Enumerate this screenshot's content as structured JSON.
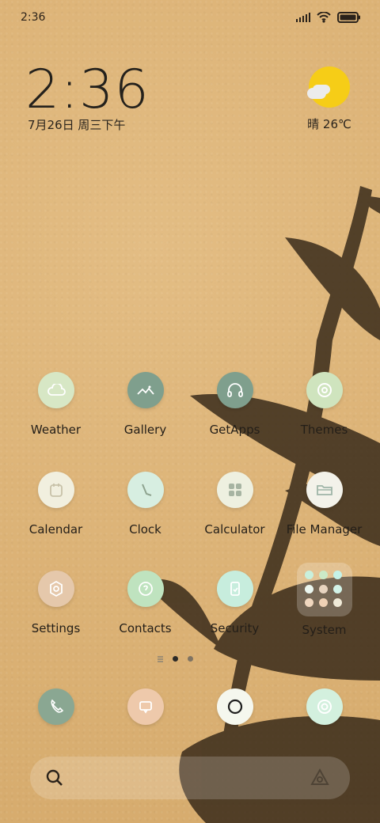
{
  "status_bar": {
    "time": "2:36",
    "icons": [
      "signal-icon",
      "wifi-icon",
      "battery-icon"
    ]
  },
  "clock_widget": {
    "time": "2:36",
    "date": "7月26日 周三下午"
  },
  "weather_widget": {
    "condition_icon": "partly-sunny-icon",
    "text": "晴 26℃"
  },
  "home_apps": [
    {
      "label": "Weather",
      "icon": "cloud-icon",
      "color": "#d7e7c5"
    },
    {
      "label": "Gallery",
      "icon": "landscape-icon",
      "color": "#7f9f8d"
    },
    {
      "label": "GetApps",
      "icon": "headset-icon",
      "color": "#7f9f8d"
    },
    {
      "label": "Themes",
      "icon": "themes-icon",
      "color": "#cfe4be"
    },
    {
      "label": "Calendar",
      "icon": "calendar-icon",
      "color": "#f1efdf"
    },
    {
      "label": "Clock",
      "icon": "clock-icon",
      "color": "#d7eee1"
    },
    {
      "label": "Calculator",
      "icon": "calculator-icon",
      "color": "#eef0e0"
    },
    {
      "label": "File Manager",
      "icon": "folder-icon",
      "color": "#f3f2ea"
    },
    {
      "label": "Settings",
      "icon": "settings-icon",
      "color": "#e5c8ab"
    },
    {
      "label": "Contacts",
      "icon": "contacts-icon",
      "color": "#bfe3bf"
    },
    {
      "label": "Security",
      "icon": "security-icon",
      "color": "#c7eddd"
    },
    {
      "label": "System",
      "icon": "system-folder-icon",
      "color": "#f0ddb6"
    }
  ],
  "folder_dots": [
    "#c9f0dc",
    "#cbe9c7",
    "#c5f2e8",
    "#ebf6ef",
    "#e8d4c0",
    "#d3f3e8",
    "#f0d7bf",
    "#f0d1b5",
    "#f0ead8"
  ],
  "pager": [
    "menu-icon",
    "page-dot-active",
    "page-dot"
  ],
  "dock_apps": [
    {
      "icon": "phone-icon",
      "color": "#8aa792"
    },
    {
      "icon": "messages-icon",
      "color": "#eec9ab"
    },
    {
      "icon": "browser-icon",
      "color": "#f5f7ee"
    },
    {
      "icon": "camera-icon",
      "color": "#d3f0de"
    }
  ],
  "search_bar": {
    "search_icon": "search-icon",
    "assistant_icon": "assistant-icon"
  }
}
